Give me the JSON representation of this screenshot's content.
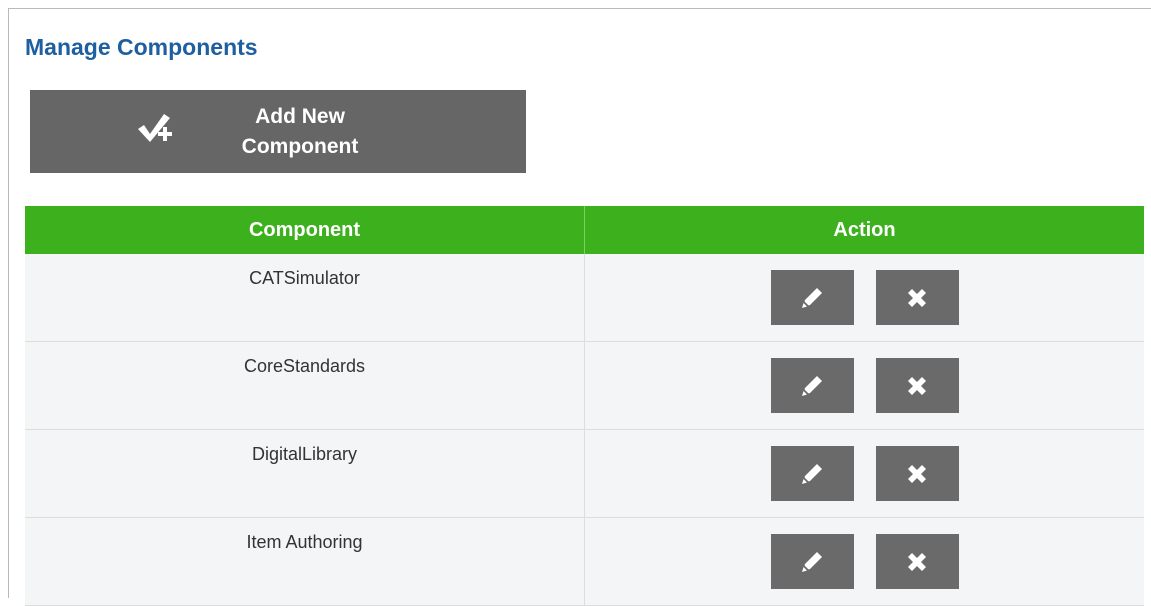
{
  "page": {
    "title": "Manage Components"
  },
  "add_button": {
    "label": "Add New Component",
    "icon": "check-plus-icon"
  },
  "table": {
    "headers": [
      "Component",
      "Action"
    ],
    "rows": [
      {
        "name": "CATSimulator"
      },
      {
        "name": "CoreStandards"
      },
      {
        "name": "DigitalLibrary"
      },
      {
        "name": "Item Authoring"
      }
    ],
    "action_icons": [
      "pencil-icon",
      "close-icon"
    ]
  },
  "colors": {
    "title": "#1d5fa0",
    "header_bg": "#3db01e",
    "button_bg": "#666666",
    "row_bg": "#f4f5f7"
  }
}
